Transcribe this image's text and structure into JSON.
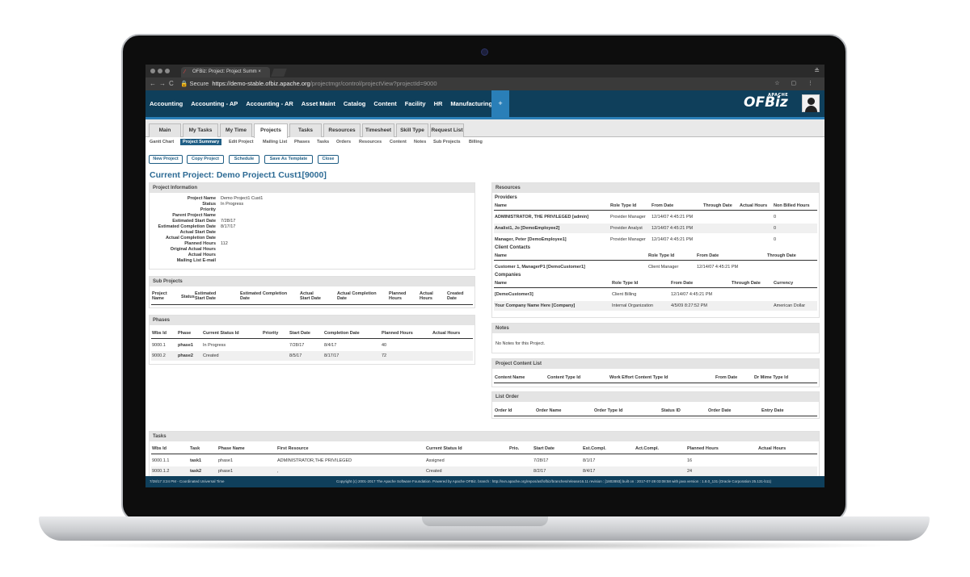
{
  "browser": {
    "tab_title": "OFBiz: Project: Project Summ",
    "secure_label": "Secure",
    "url_host": "https://demo-stable.ofbiz.apache.org",
    "url_path": "/projectmgr/control/projectView?projectId=9000"
  },
  "app_menu": [
    "Accounting",
    "Accounting - AP",
    "Accounting - AR",
    "Asset Maint",
    "Catalog",
    "Content",
    "Facility",
    "HR",
    "Manufacturing"
  ],
  "app_plus": "+",
  "logo": {
    "text": "OFBiz",
    "small": "APACHE"
  },
  "main_tabs": [
    "Main",
    "My Tasks",
    "My Time",
    "Projects",
    "Tasks",
    "Resources",
    "Timesheet",
    "Skill Type",
    "Request List"
  ],
  "sub_tabs": [
    "Gantt Chart",
    "Project Summary",
    "Edit Project",
    "Mailing List",
    "Phases",
    "Tasks",
    "Orders",
    "Resources",
    "Content",
    "Notes",
    "Sub Projects",
    "Billing"
  ],
  "action_buttons": [
    "New Project",
    "Copy Project",
    "Schedule",
    "Save As Template",
    "Close"
  ],
  "current_project": "Current Project: Demo Project1 Cust1[9000]",
  "project_info": {
    "title": "Project Information",
    "fields": [
      {
        "label": "Project Name",
        "value": "Demo Project1 Cust1"
      },
      {
        "label": "Status",
        "value": "In Progress"
      },
      {
        "label": "Priority",
        "value": ""
      },
      {
        "label": "Parent Project Name",
        "value": ""
      },
      {
        "label": "Estimated Start Date",
        "value": "7/28/17"
      },
      {
        "label": "Estimated Completion Date",
        "value": "8/17/17"
      },
      {
        "label": "Actual Start Date",
        "value": ""
      },
      {
        "label": "Actual Completion Date",
        "value": ""
      },
      {
        "label": "Planned Hours",
        "value": "112"
      },
      {
        "label": "Original Actual Hours",
        "value": ""
      },
      {
        "label": "Actual Hours",
        "value": ""
      },
      {
        "label": "Mailing List E-mail",
        "value": ""
      }
    ]
  },
  "sub_projects": {
    "title": "Sub Projects",
    "headers": [
      "Project Name",
      "Status",
      "Estimated Start Date",
      "Estimated Completion Date",
      "Actual Start Date",
      "Actual Completion Date",
      "Planned Hours",
      "Actual Hours",
      "Created Date"
    ]
  },
  "phases": {
    "title": "Phases",
    "headers": [
      "Wbs Id",
      "Phase",
      "Current Status Id",
      "Priority",
      "Start Date",
      "Completion Date",
      "Planned Hours",
      "Actual Hours"
    ],
    "rows": [
      [
        "9000.1",
        "phase1",
        "In Progress",
        "",
        "7/28/17",
        "8/4/17",
        "40",
        ""
      ],
      [
        "9000.2",
        "phase2",
        "Created",
        "",
        "8/5/17",
        "8/17/17",
        "72",
        ""
      ]
    ]
  },
  "resources": {
    "title": "Resources",
    "providers_title": "Providers",
    "providers_headers": [
      "Name",
      "Role Type Id",
      "From Date",
      "Through Date",
      "Actual Hours",
      "Non Billed Hours"
    ],
    "providers_rows": [
      [
        "ADMINISTRATOR, THE PRIVILEGED [admin]",
        "Provider Manager",
        "12/14/07 4:45:21 PM",
        "",
        "",
        "0"
      ],
      [
        "Analist1, Jo [DemoEmployee2]",
        "Provider Analyst",
        "12/14/07 4:45:21 PM",
        "",
        "",
        "0"
      ],
      [
        "Manager, Peter [DemoEmployee1]",
        "Provider Manager",
        "12/14/07 4:45:21 PM",
        "",
        "",
        "0"
      ]
    ],
    "client_title": "Client Contacts",
    "client_headers": [
      "Name",
      "Role Type Id",
      "From Date",
      "Through Date"
    ],
    "client_rows": [
      [
        "Customer 1, ManagerP1 [DemoCustomer1]",
        "Client Manager",
        "12/14/07 4:45:21 PM",
        ""
      ]
    ],
    "companies_title": "Companies",
    "companies_headers": [
      "Name",
      "Role Type Id",
      "From Date",
      "Through Date",
      "Currency"
    ],
    "companies_rows": [
      [
        "[DemoCustomer3]",
        "Client Billing",
        "12/14/07 4:45:21 PM",
        "",
        ""
      ],
      [
        "Your Company Name Here [Company]",
        "Internal Organization",
        "4/5/09 8:27:52 PM",
        "",
        "American Dollar"
      ]
    ]
  },
  "notes": {
    "title": "Notes",
    "text": "No Notes for this Project."
  },
  "content_list": {
    "title": "Project Content List",
    "headers": [
      "Content Name",
      "Content Type Id",
      "Work Effort Content Type Id",
      "From Date",
      "Dr Mime Type Id"
    ]
  },
  "list_order": {
    "title": "List Order",
    "headers": [
      "Order Id",
      "Order Name",
      "Order Type Id",
      "Status ID",
      "Order Date",
      "Entry Date"
    ]
  },
  "tasks": {
    "title": "Tasks",
    "headers": [
      "Wbs Id",
      "Task",
      "Phase Name",
      "First Resource",
      "Current Status Id",
      "Prio.",
      "Start Date",
      "Est.Compl.",
      "Act.Compl.",
      "Planned Hours",
      "Actual Hours"
    ],
    "rows": [
      [
        "9000.1.1",
        "task1",
        "phase1",
        "ADMINISTRATOR,THE PRIVILEGED",
        "Assigned",
        "",
        "7/28/17",
        "8/1/17",
        "",
        "16",
        ""
      ],
      [
        "9000.1.2",
        "task2",
        "phase1",
        ",",
        "Created",
        "",
        "8/2/17",
        "8/4/17",
        "",
        "24",
        ""
      ]
    ]
  },
  "footer": {
    "time": "7/28/17 3:24 PM - Coordinated Universal Time",
    "copyright": "Copyright (c) 2001-2017 The Apache Software Foundation. Powered by Apache OFBiz. branch : http://svn.apache.org/repos/asf/ofbiz/branches/release16.11 revision : [1802893] built on : 2017-07-28 03:08:58 with java version : 1.8.0_131 (Oracle Corporation 25.131-b11)"
  }
}
